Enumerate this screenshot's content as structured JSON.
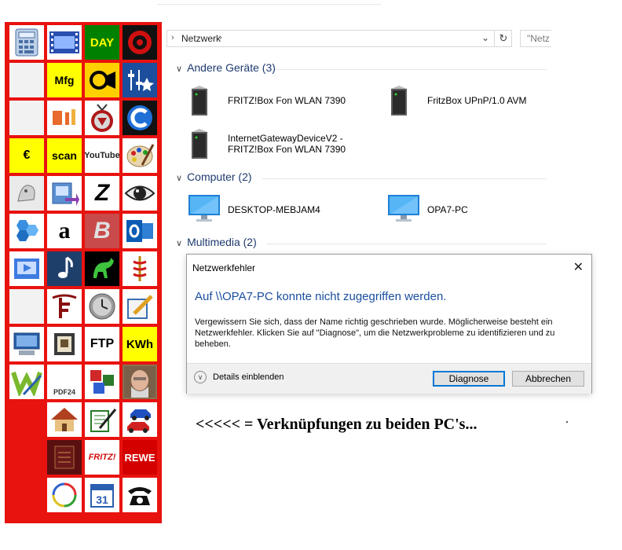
{
  "launcher": {
    "text_tiles": {
      "day": "DAY",
      "mfg": "Mfg",
      "euro": "€",
      "scan": "scan",
      "youtube": "YouTube",
      "z": "Z",
      "b": "B",
      "ftp": "FTP",
      "kwh": "KWh",
      "pdf24": "PDF24",
      "fritz": "FRITZ!",
      "rewe": "REWE",
      "amazon": "a",
      "cal": "31"
    },
    "colors": {
      "background": "#e8120f",
      "tile": "#ffffff",
      "yellow": "#ffff00",
      "green": "#008000",
      "rewe": "#d40000"
    }
  },
  "explorer": {
    "address": {
      "location": "Netzwerk",
      "search_placeholder": "\"Netz"
    },
    "groups": [
      {
        "title": "Andere Geräte (3)",
        "items": [
          "FRITZ!Box Fon WLAN 7390",
          "FritzBox UPnP/1.0 AVM",
          "InternetGatewayDeviceV2 -",
          "FRITZ!Box Fon WLAN 7390"
        ]
      },
      {
        "title": "Computer (2)",
        "items": [
          "DESKTOP-MEBJAM4",
          "OPA7-PC"
        ]
      },
      {
        "title": "Multimedia (2)",
        "items": []
      }
    ]
  },
  "dialog": {
    "title": "Netzwerkfehler",
    "heading": "Auf \\\\OPA7-PC konnte nicht zugegriffen werden.",
    "message": "Vergewissern Sie sich, dass der Name richtig geschrieben wurde. Möglicherweise besteht ein Netzwerkfehler. Klicken Sie auf \"Diagnose\", um die Netzwerkprobleme zu identifizieren und zu beheben.",
    "details_label": "Details einblenden",
    "diagnose_button": "Diagnose",
    "cancel_button": "Abbrechen",
    "close_glyph": "✕",
    "accent": "#1b4fa0"
  },
  "caption": "<<<<< = Verknüpfungen zu beiden PC's..."
}
